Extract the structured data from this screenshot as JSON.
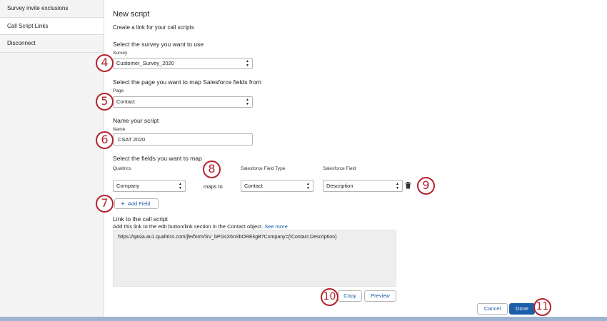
{
  "sidebar": {
    "items": [
      {
        "label": "Survey invite exclusions"
      },
      {
        "label": "Call Script Links"
      },
      {
        "label": "Disconnect"
      }
    ]
  },
  "form": {
    "title": "New script",
    "subtitle": "Create a link for your call scripts",
    "survey_section": "Select the survey you want to use",
    "survey_label": "Survey",
    "survey_value": "Customer_Survey_2020",
    "page_section": "Select the page you want to map Salesforce fields from",
    "page_label": "Page",
    "page_value": "Contact",
    "name_section": "Name your script",
    "name_label": "Name",
    "name_value": "CSAT 2020",
    "fields_section": "Select the fields you want to map",
    "col_qualtrics": "Qualtrics",
    "col_sf_type": "Salesforce Field Type",
    "col_sf_field": "Salesforce Field",
    "mapping": {
      "qualtrics_value": "Company",
      "maps_to": "maps to",
      "type_value": "Contact",
      "field_value": "Description"
    },
    "add_field_label": "Add Field",
    "link_section": "Link to the call script",
    "link_desc": "Add this link to the edit button/link section in the Contact object.",
    "see_more": "See more",
    "link_url": "https://qasia.au1.qualtrics.com/jfe/form/SV_bPGsX6nSbOREkgB?Company={!Contact.Description}",
    "copy_label": "Copy",
    "preview_label": "Preview"
  },
  "footer": {
    "cancel_label": "Cancel",
    "done_label": "Done"
  },
  "callouts": [
    "4",
    "5",
    "6",
    "7",
    "8",
    "9",
    "10",
    "11"
  ],
  "colors": {
    "accent": "#1a5ea8",
    "callout": "#b3232e"
  }
}
